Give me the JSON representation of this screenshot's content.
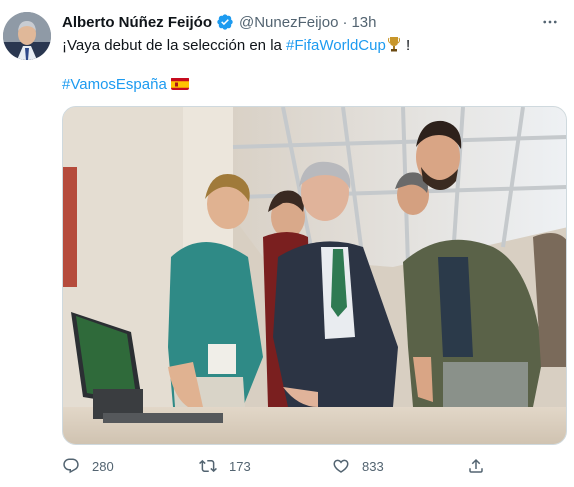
{
  "tweet": {
    "author_name": "Alberto Núñez Feijóo",
    "handle": "@NunezFeijoo",
    "separator": "·",
    "time": "13h",
    "text_before": "¡Vaya debut de la selección en la ",
    "hashtag1": "#FifaWorldCup",
    "text_after": " !",
    "hashtag2": "#VamosEspaña",
    "emoji_trophy": "trophy-icon",
    "emoji_flag": "spain-flag-icon"
  },
  "actions": {
    "replies": "280",
    "retweets": "173",
    "likes": "833"
  },
  "colors": {
    "link": "#1d9bf0",
    "secondary_text": "#536471",
    "verified": "#1d9bf0"
  },
  "icons": [
    "verified-badge-icon",
    "more-options-icon",
    "reply-icon",
    "retweet-icon",
    "like-icon",
    "share-icon"
  ]
}
